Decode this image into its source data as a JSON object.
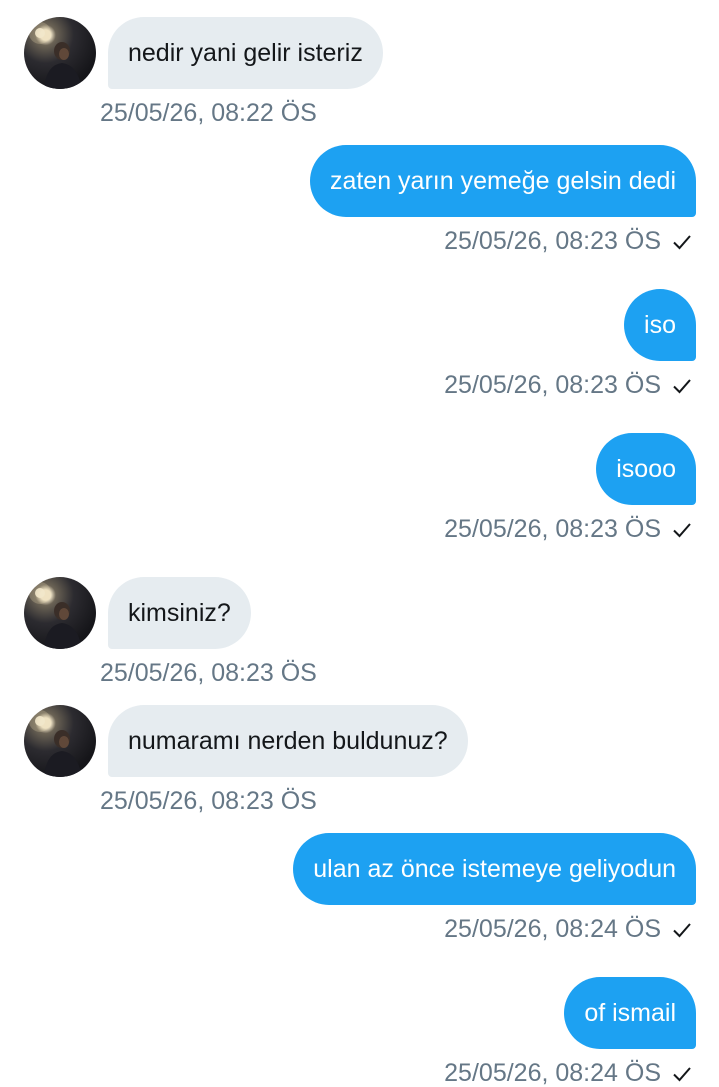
{
  "messages": [
    {
      "direction": "in",
      "text": "nedir yani gelir isteriz",
      "time": "25/05/26, 08:22 ÖS",
      "avatar_icon": "profile-photo"
    },
    {
      "direction": "out",
      "text": "zaten yarın yemeğe gelsin dedi",
      "time": "25/05/26, 08:23 ÖS",
      "status_icon": "check-icon"
    },
    {
      "direction": "out",
      "text": "iso",
      "time": "25/05/26, 08:23 ÖS",
      "status_icon": "check-icon"
    },
    {
      "direction": "out",
      "text": "isooo",
      "time": "25/05/26, 08:23 ÖS",
      "status_icon": "check-icon"
    },
    {
      "direction": "in",
      "text": "kimsiniz?",
      "time": "25/05/26, 08:23 ÖS",
      "avatar_icon": "profile-photo"
    },
    {
      "direction": "in",
      "text": "numaramı nerden buldunuz?",
      "time": "25/05/26, 08:23 ÖS",
      "avatar_icon": "profile-photo"
    },
    {
      "direction": "out",
      "text": "ulan az önce istemeye geliyodun",
      "time": "25/05/26, 08:24 ÖS",
      "status_icon": "check-icon"
    },
    {
      "direction": "out",
      "text": "of ismail",
      "time": "25/05/26, 08:24 ÖS",
      "status_icon": "check-icon"
    }
  ],
  "colors": {
    "outgoing_bubble": "#1da1f2",
    "incoming_bubble": "#e6ecf0",
    "timestamp": "#657786",
    "background": "#ffffff"
  }
}
